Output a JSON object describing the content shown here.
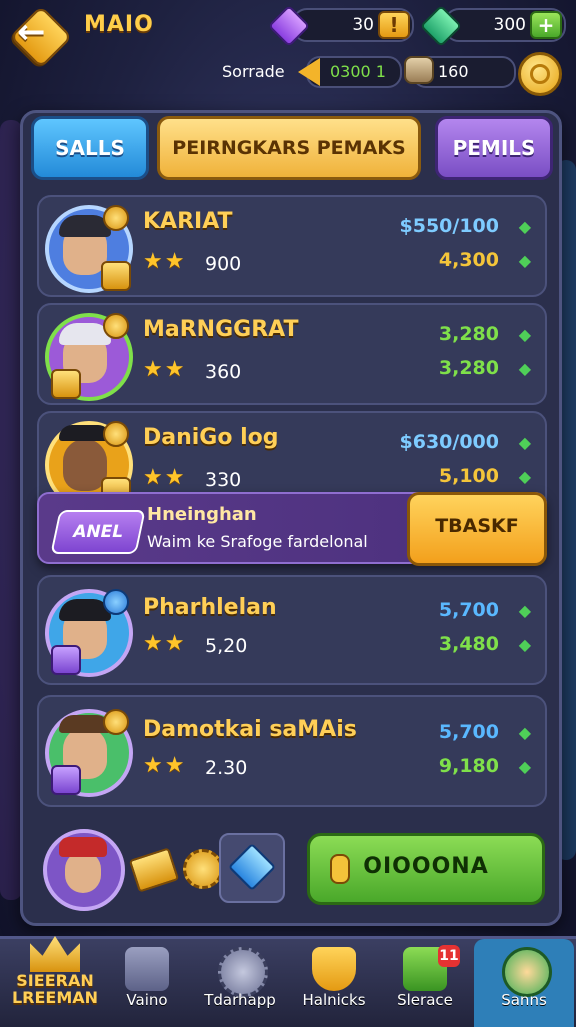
{
  "header": {
    "title": "MAIO",
    "gems": "30",
    "cash": "300",
    "sub_label": "Sorrade",
    "counter_a": "0300 1",
    "counter_b": "160"
  },
  "tabs": [
    "SALLS",
    "PEIRNGKARS PEMAKS",
    "PEMILS"
  ],
  "players": [
    {
      "name": "KARIAT",
      "level": "900",
      "v1": "$550/100",
      "v2": "4,300",
      "v1_color": "#7ecbff"
    },
    {
      "name": "MaRNGGRAT",
      "level": "360",
      "v1": "3,280",
      "v2": "3,280",
      "v1_color": "#7fe04a"
    },
    {
      "name": "DaniGo log",
      "level": "330",
      "v1": "$630/000",
      "v2": "5,100",
      "v1_color": "#7ecbff"
    },
    {
      "name": "Pharhlelan",
      "level": "5,20",
      "v1": "5,700",
      "v2": "3,480",
      "v1_color": "#5ab8ff"
    },
    {
      "name": "Damotkai saMAis",
      "level": "2.30",
      "v1": "5,700",
      "v2": "9,180",
      "v1_color": "#5ab8ff"
    }
  ],
  "promo": {
    "badge": "ANEL",
    "title": "Hneinghan",
    "text": "Waim ke Srafoge fardelonal",
    "button": "TBASKF"
  },
  "action_button": "OIOOONA",
  "nav": {
    "logo": "SIEERAN LREEMAN",
    "items": [
      "Vaino",
      "Tdarhapp",
      "Halnicks",
      "Slerace",
      "Sanns"
    ],
    "badge": "11"
  }
}
